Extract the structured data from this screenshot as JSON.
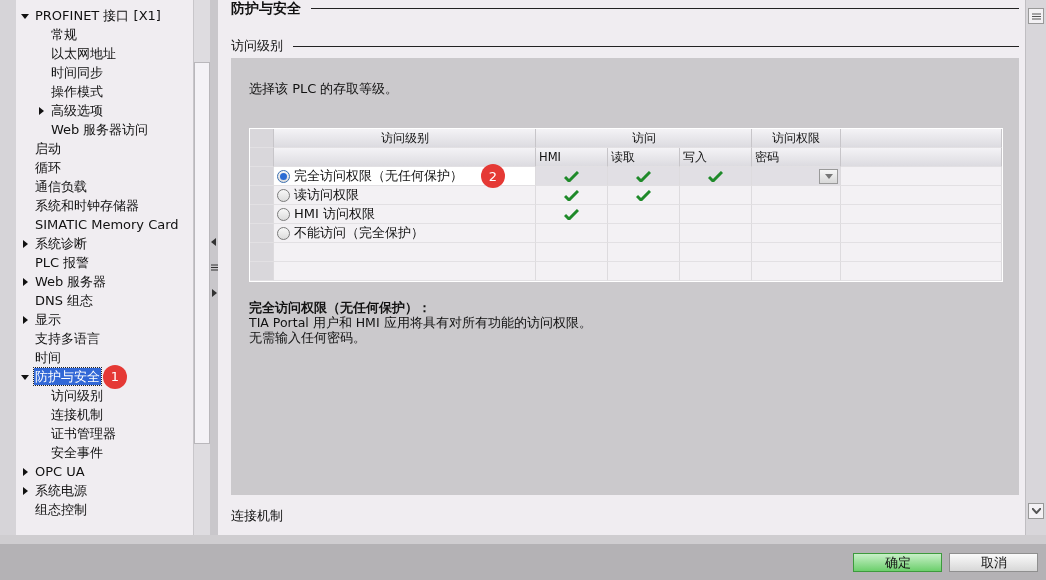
{
  "tree": [
    {
      "label": "PROFINET 接口 [X1]",
      "expanded": true,
      "selected": false,
      "children": [
        {
          "label": "常规",
          "selected": false
        },
        {
          "label": "以太网地址",
          "selected": false
        },
        {
          "label": "时间同步",
          "selected": false
        },
        {
          "label": "操作模式",
          "selected": false
        },
        {
          "label": "高级选项",
          "expanded": false,
          "selected": false
        },
        {
          "label": "Web 服务器访问",
          "selected": false
        }
      ]
    },
    {
      "label": "启动",
      "selected": false
    },
    {
      "label": "循环",
      "selected": false
    },
    {
      "label": "通信负载",
      "selected": false
    },
    {
      "label": "系统和时钟存储器",
      "selected": false
    },
    {
      "label": "SIMATIC Memory Card",
      "selected": false
    },
    {
      "label": "系统诊断",
      "expanded": false,
      "selected": false
    },
    {
      "label": "PLC 报警",
      "selected": false
    },
    {
      "label": "Web 服务器",
      "expanded": false,
      "selected": false
    },
    {
      "label": "DNS 组态",
      "selected": false
    },
    {
      "label": "显示",
      "expanded": false,
      "selected": false
    },
    {
      "label": "支持多语言",
      "selected": false
    },
    {
      "label": "时间",
      "selected": false
    },
    {
      "label": "防护与安全",
      "expanded": true,
      "selected": true,
      "badge": "1",
      "children": [
        {
          "label": "访问级别",
          "selected": false
        },
        {
          "label": "连接机制",
          "selected": false
        },
        {
          "label": "证书管理器",
          "selected": false
        },
        {
          "label": "安全事件",
          "selected": false
        }
      ]
    },
    {
      "label": "OPC UA",
      "expanded": false,
      "selected": false
    },
    {
      "label": "系统电源",
      "expanded": false,
      "selected": false
    },
    {
      "label": "组态控制",
      "selected": false
    }
  ],
  "section_title": "防护与安全",
  "subsection_title": "访问级别",
  "intro": "选择该 PLC 的存取等级。",
  "table": {
    "group_headers": [
      "访问级别",
      "访问",
      "访问权限"
    ],
    "columns": [
      "HMI",
      "读取",
      "写入",
      "密码"
    ],
    "rows": [
      {
        "label": "完全访问权限（无任何保护）",
        "selected": true,
        "badge": "2",
        "hmi": true,
        "read": true,
        "write": true,
        "password_dropdown": true
      },
      {
        "label": "读访问权限",
        "selected": false,
        "hmi": true,
        "read": true,
        "write": false,
        "password_dropdown": false
      },
      {
        "label": "HMI 访问权限",
        "selected": false,
        "hmi": true,
        "read": false,
        "write": false,
        "password_dropdown": false
      },
      {
        "label": "不能访问（完全保护）",
        "selected": false,
        "hmi": false,
        "read": false,
        "write": false,
        "password_dropdown": false
      }
    ]
  },
  "description": {
    "title": "完全访问权限（无任何保护）：",
    "lines": [
      "TIA Portal 用户和 HMI 应用将具有对所有功能的访问权限。",
      "无需输入任何密码。"
    ]
  },
  "next_section": "连接机制",
  "buttons": [
    {
      "label": "确定",
      "primary": true
    },
    {
      "label": "取消",
      "primary": false
    }
  ]
}
